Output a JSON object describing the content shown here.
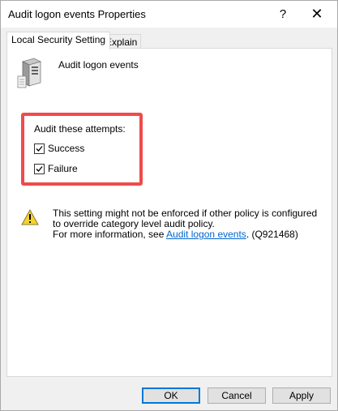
{
  "window": {
    "title": "Audit logon events Properties",
    "help_glyph": "?",
    "close_glyph": "✕"
  },
  "tabs": [
    {
      "label": "Local Security Setting",
      "active": true
    },
    {
      "label": "Explain",
      "active": false
    }
  ],
  "policy": {
    "name": "Audit logon events",
    "icon": "server-policy-icon"
  },
  "audit": {
    "heading": "Audit these attempts:",
    "success": {
      "label": "Success",
      "checked": true
    },
    "failure": {
      "label": "Failure",
      "checked": true
    }
  },
  "warning": {
    "icon": "warning-icon",
    "line1": "This setting might not be enforced if other policy is configured to override category level audit policy.",
    "more_prefix": "For more information, see ",
    "link_text": "Audit logon events",
    "more_suffix": ". (Q921468)"
  },
  "buttons": {
    "ok": "OK",
    "cancel": "Cancel",
    "apply": "Apply"
  },
  "colors": {
    "highlight": "#f04b4b",
    "link": "#0066cc",
    "focus": "#0078d7"
  }
}
